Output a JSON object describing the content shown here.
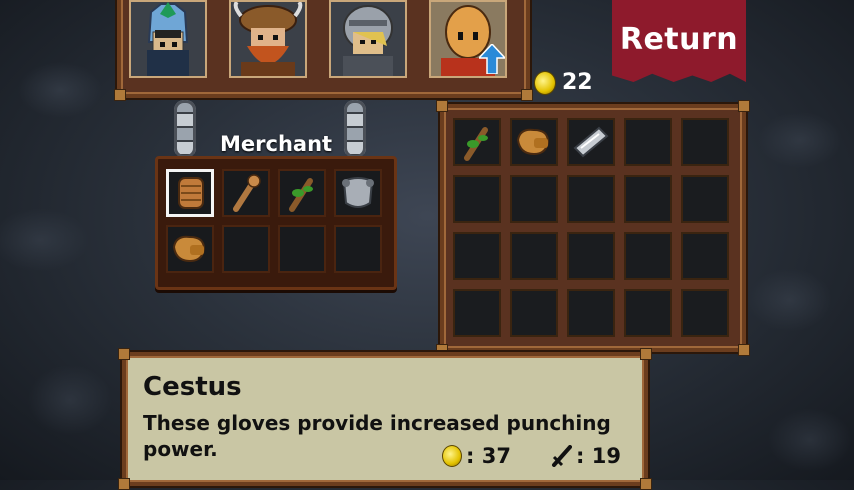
{
  "return_button": {
    "label": "Return"
  },
  "gold": {
    "amount": "22",
    "icon": "gold-coin-icon"
  },
  "party": {
    "members": [
      {
        "name": "knight-portrait",
        "icon": "blue-helmet-hero-icon"
      },
      {
        "name": "viking-portrait",
        "icon": "fur-hat-hero-icon"
      },
      {
        "name": "visor-portrait",
        "icon": "helmeted-hero-icon"
      },
      {
        "name": "monk-portrait",
        "icon": "bald-hero-icon",
        "selected": true,
        "upgrade_icon": "blue-up-arrow-icon"
      }
    ]
  },
  "merchant": {
    "title": "Merchant",
    "items": [
      {
        "icon": "cestus-gloves-icon",
        "selected": true
      },
      {
        "icon": "wooden-staff-icon"
      },
      {
        "icon": "leafy-club-icon"
      },
      {
        "icon": "steel-breastplate-icon"
      },
      {
        "icon": "leather-gloves-icon"
      },
      {
        "icon": "empty"
      },
      {
        "icon": "empty"
      },
      {
        "icon": "empty"
      }
    ]
  },
  "inventory": {
    "items": [
      {
        "icon": "leafy-club-icon"
      },
      {
        "icon": "leather-gloves-icon"
      },
      {
        "icon": "steel-bracer-icon"
      }
    ],
    "columns": 5,
    "rows": 4
  },
  "item_info": {
    "name": "Cestus",
    "description": "These gloves provide increased punching power.",
    "price": ": 37",
    "attack": ": 19",
    "price_icon": "gold-coin-icon",
    "attack_icon": "sword-icon"
  },
  "colors": {
    "return_banner": "#8e1a2c",
    "panel_wood": "#5a3220",
    "desc_panel": "#c9c6a4"
  }
}
